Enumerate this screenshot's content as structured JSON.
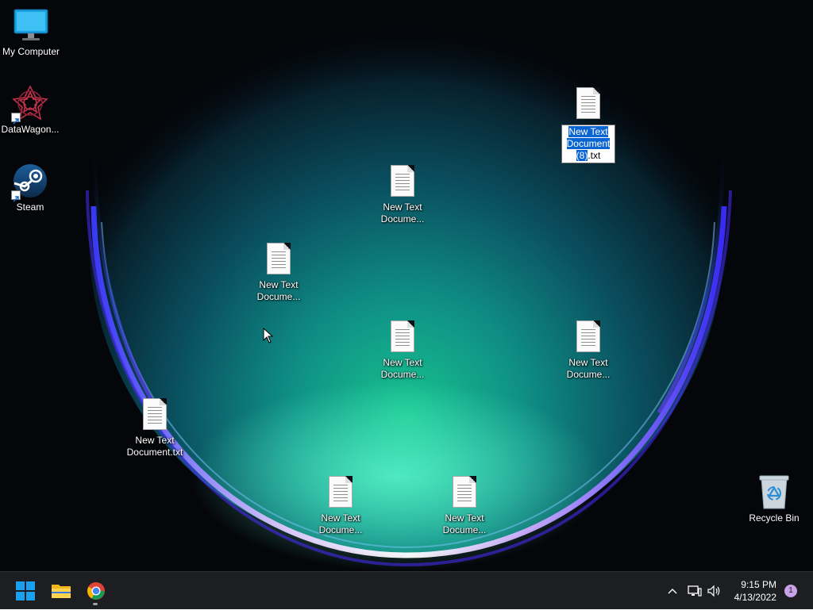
{
  "desktop": {
    "icons": {
      "my_computer": {
        "label": "My Computer",
        "icon": "monitor-icon"
      },
      "datawagon": {
        "label": "DataWagon...",
        "icon": "datawagon-icon"
      },
      "steam": {
        "label": "Steam",
        "icon": "steam-icon"
      },
      "recycle_bin": {
        "label": "Recycle Bin",
        "icon": "recycle-bin-icon"
      },
      "doc_renaming": {
        "label_selected_1": "New Text",
        "label_selected_2": "Document",
        "label_selected_3": "(8)",
        "label_ext": ".txt",
        "icon": "text-document-icon"
      },
      "doc_a": {
        "label": "New Text\nDocume...",
        "icon": "text-document-icon"
      },
      "doc_b": {
        "label": "New Text\nDocume...",
        "icon": "text-document-icon"
      },
      "doc_c": {
        "label": "New Text\nDocume...",
        "icon": "text-document-icon"
      },
      "doc_d": {
        "label": "New Text\nDocume...",
        "icon": "text-document-icon"
      },
      "doc_e": {
        "label": "New Text\nDocument.txt",
        "icon": "text-document-icon"
      },
      "doc_f": {
        "label": "New Text\nDocume...",
        "icon": "text-document-icon"
      },
      "doc_g": {
        "label": "New Text\nDocume...",
        "icon": "text-document-icon"
      }
    }
  },
  "taskbar": {
    "start": {
      "icon": "windows-start-icon"
    },
    "file_explorer": {
      "icon": "folder-icon"
    },
    "chrome": {
      "icon": "chrome-icon"
    },
    "tray": {
      "overflow_icon": "chevron-up-icon",
      "network_icon": "network-icon",
      "volume_icon": "volume-icon"
    },
    "clock": {
      "time": "9:15 PM",
      "date": "4/13/2022"
    },
    "notifications": {
      "count": "1"
    }
  },
  "colors": {
    "taskbar_bg": "#1c1e22",
    "selection": "#0a64d2",
    "windows_blue": "#1aa0ef"
  }
}
